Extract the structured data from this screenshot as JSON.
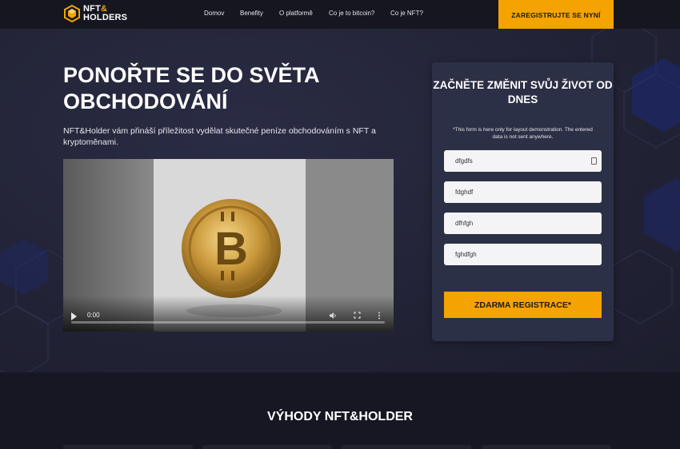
{
  "header": {
    "logo_line1": "NFT",
    "logo_amp": "&",
    "logo_line2": "HOLDERS",
    "nav": [
      "Domov",
      "Benefity",
      "O platformě",
      "Co je to bitcoin?",
      "Co je NFT?"
    ],
    "cta_label": "ZAREGISTRUJTE SE NYNÍ"
  },
  "hero": {
    "headline": "PONOŘTE SE DO SVĚTA OBCHODOVÁNÍ",
    "subtext": "NFT&Holder vám přináší příležitost vydělat skutečné peníze obchodováním s NFT a kryptoměnami."
  },
  "video": {
    "time": "0:00",
    "progress_fraction": 0
  },
  "form": {
    "title": "ZAČNĚTE ZMĚNIT SVŮJ ŽIVOT OD DNES",
    "note": "*This form is here only for layout demonstration. The entered data is not sent anywhere.",
    "fields": [
      "dfgdfs",
      "fdghdf",
      "dfhfgh",
      "fghdfgh"
    ],
    "submit_label": "ZDARMA REGISTRACE*"
  },
  "benefits": {
    "title": "VÝHODY NFT&HOLDER"
  },
  "colors": {
    "accent": "#f5a300",
    "background": "#1c1d2b",
    "card": "#2c3046"
  },
  "icons": {
    "play": "play-icon",
    "volume": "volume-icon",
    "fullscreen": "fullscreen-icon",
    "more": "more-vertical-icon",
    "key": "key-icon"
  }
}
